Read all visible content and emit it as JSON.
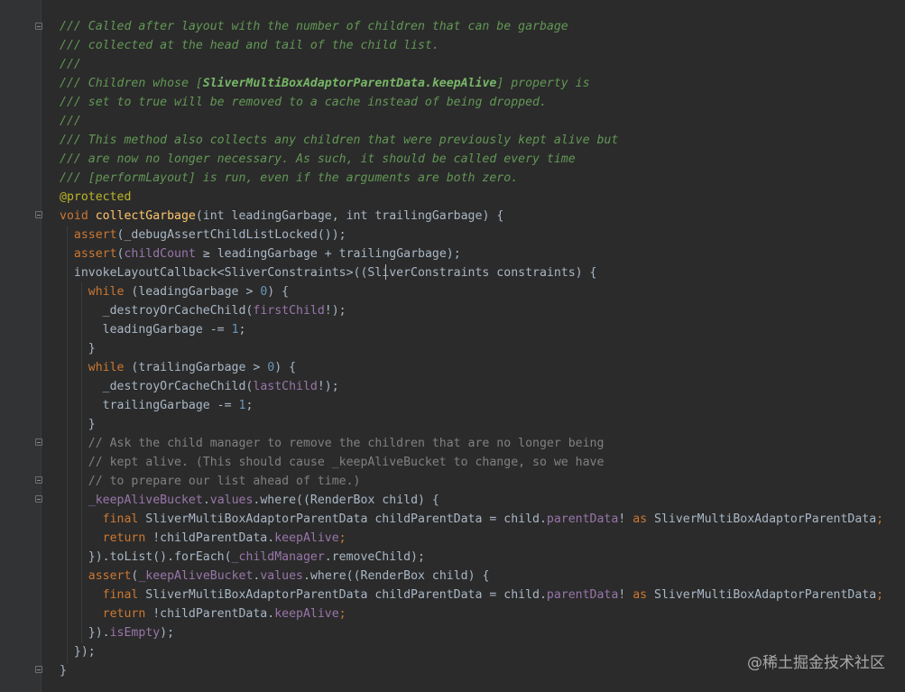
{
  "watermark": "@稀土掘金技术社区",
  "code_lines": [
    [
      {
        "t": "/// Called after layout with the number of children that can be garbage",
        "c": "doc"
      }
    ],
    [
      {
        "t": "/// collected at the head and tail of the child list.",
        "c": "doc"
      }
    ],
    [
      {
        "t": "///",
        "c": "doc"
      }
    ],
    [
      {
        "t": "/// Children whose [",
        "c": "doc"
      },
      {
        "t": "SliverMultiBoxAdaptorParentData.keepAlive",
        "c": "docref"
      },
      {
        "t": "] property is",
        "c": "doc"
      }
    ],
    [
      {
        "t": "/// set to true will be removed to a cache instead of being dropped.",
        "c": "doc"
      }
    ],
    [
      {
        "t": "///",
        "c": "doc"
      }
    ],
    [
      {
        "t": "/// This method also collects any children that were previously kept alive but",
        "c": "doc"
      }
    ],
    [
      {
        "t": "/// are now no longer necessary. As such, it should be called every time",
        "c": "doc"
      }
    ],
    [
      {
        "t": "/// [performLayout] is run, even if the arguments are both zero.",
        "c": "doc"
      }
    ],
    [
      {
        "t": "@protected",
        "c": "ann"
      }
    ],
    [
      {
        "t": "void ",
        "c": "kw"
      },
      {
        "t": "collectGarbage",
        "c": "fn"
      },
      {
        "t": "(int leadingGarbage, int trailingGarbage) {",
        "c": "plain"
      }
    ],
    [
      {
        "t": "  ",
        "c": "plain"
      },
      {
        "t": "assert",
        "c": "kw"
      },
      {
        "t": "(_debugAssertChildListLocked());",
        "c": "plain"
      }
    ],
    [
      {
        "t": "  ",
        "c": "plain"
      },
      {
        "t": "assert",
        "c": "kw"
      },
      {
        "t": "(",
        "c": "plain"
      },
      {
        "t": "childCount",
        "c": "field"
      },
      {
        "t": " ≥ leadingGarbage + trailingGarbage);",
        "c": "plain"
      }
    ],
    [
      {
        "t": "  invokeLayoutCallback<SliverConstraints>((SliverConstraints constraints) {",
        "c": "plain"
      }
    ],
    [
      {
        "t": "    ",
        "c": "plain"
      },
      {
        "t": "while",
        "c": "kw"
      },
      {
        "t": " (leadingGarbage > ",
        "c": "plain"
      },
      {
        "t": "0",
        "c": "num"
      },
      {
        "t": ") {",
        "c": "plain"
      }
    ],
    [
      {
        "t": "      _destroyOrCacheChild(",
        "c": "plain"
      },
      {
        "t": "firstChild",
        "c": "field"
      },
      {
        "t": "!);",
        "c": "plain"
      }
    ],
    [
      {
        "t": "      leadingGarbage -= ",
        "c": "plain"
      },
      {
        "t": "1",
        "c": "num"
      },
      {
        "t": ";",
        "c": "plain"
      }
    ],
    [
      {
        "t": "    }",
        "c": "plain"
      }
    ],
    [
      {
        "t": "    ",
        "c": "plain"
      },
      {
        "t": "while",
        "c": "kw"
      },
      {
        "t": " (trailingGarbage > ",
        "c": "plain"
      },
      {
        "t": "0",
        "c": "num"
      },
      {
        "t": ") {",
        "c": "plain"
      }
    ],
    [
      {
        "t": "      _destroyOrCacheChild(",
        "c": "plain"
      },
      {
        "t": "lastChild",
        "c": "field"
      },
      {
        "t": "!);",
        "c": "plain"
      }
    ],
    [
      {
        "t": "      trailingGarbage -= ",
        "c": "plain"
      },
      {
        "t": "1",
        "c": "num"
      },
      {
        "t": ";",
        "c": "plain"
      }
    ],
    [
      {
        "t": "    }",
        "c": "plain"
      }
    ],
    [
      {
        "t": "    // Ask the child manager to remove the children that are no longer being",
        "c": "cmt"
      }
    ],
    [
      {
        "t": "    // kept alive. (This should cause _keepAliveBucket to change, so we have",
        "c": "cmt"
      }
    ],
    [
      {
        "t": "    // to prepare our list ahead of time.)",
        "c": "cmt"
      }
    ],
    [
      {
        "t": "    ",
        "c": "plain"
      },
      {
        "t": "_keepAliveBucket",
        "c": "field"
      },
      {
        "t": ".",
        "c": "plain"
      },
      {
        "t": "values",
        "c": "field"
      },
      {
        "t": ".where((RenderBox child) {",
        "c": "plain"
      }
    ],
    [
      {
        "t": "      ",
        "c": "plain"
      },
      {
        "t": "final ",
        "c": "kw"
      },
      {
        "t": "SliverMultiBoxAdaptorParentData childParentData = child.",
        "c": "plain"
      },
      {
        "t": "parentData",
        "c": "field"
      },
      {
        "t": "! ",
        "c": "plain"
      },
      {
        "t": "as ",
        "c": "kw"
      },
      {
        "t": "SliverMultiBoxAdaptorParentData",
        "c": "plain"
      },
      {
        "t": ";",
        "c": "kw"
      }
    ],
    [
      {
        "t": "      ",
        "c": "plain"
      },
      {
        "t": "return ",
        "c": "kw"
      },
      {
        "t": "!childParentData.",
        "c": "plain"
      },
      {
        "t": "keepAlive",
        "c": "field"
      },
      {
        "t": ";",
        "c": "kw"
      }
    ],
    [
      {
        "t": "    }).toList().forEach(",
        "c": "plain"
      },
      {
        "t": "_childManager",
        "c": "field"
      },
      {
        "t": ".removeChild);",
        "c": "plain"
      }
    ],
    [
      {
        "t": "    ",
        "c": "plain"
      },
      {
        "t": "assert",
        "c": "kw"
      },
      {
        "t": "(",
        "c": "plain"
      },
      {
        "t": "_keepAliveBucket",
        "c": "field"
      },
      {
        "t": ".",
        "c": "plain"
      },
      {
        "t": "values",
        "c": "field"
      },
      {
        "t": ".where((RenderBox child) {",
        "c": "plain"
      }
    ],
    [
      {
        "t": "      ",
        "c": "plain"
      },
      {
        "t": "final ",
        "c": "kw"
      },
      {
        "t": "SliverMultiBoxAdaptorParentData childParentData = child.",
        "c": "plain"
      },
      {
        "t": "parentData",
        "c": "field"
      },
      {
        "t": "! ",
        "c": "plain"
      },
      {
        "t": "as ",
        "c": "kw"
      },
      {
        "t": "SliverMultiBoxAdaptorParentData",
        "c": "plain"
      },
      {
        "t": ";",
        "c": "kw"
      }
    ],
    [
      {
        "t": "      ",
        "c": "plain"
      },
      {
        "t": "return ",
        "c": "kw"
      },
      {
        "t": "!childParentData.",
        "c": "plain"
      },
      {
        "t": "keepAlive",
        "c": "field"
      },
      {
        "t": ";",
        "c": "kw"
      }
    ],
    [
      {
        "t": "    }).",
        "c": "plain"
      },
      {
        "t": "isEmpty",
        "c": "field"
      },
      {
        "t": ");",
        "c": "plain"
      }
    ],
    [
      {
        "t": "  });",
        "c": "plain"
      }
    ],
    [
      {
        "t": "}",
        "c": "plain"
      }
    ]
  ],
  "colors": {
    "background": "#2b2b2b",
    "gutter": "#313335",
    "doc_comment": "#629755",
    "line_comment": "#808080",
    "keyword": "#cc7832",
    "annotation": "#bbb529",
    "function": "#ffc66d",
    "field": "#9876aa",
    "number": "#6897bb",
    "plain": "#a9b7c6"
  }
}
